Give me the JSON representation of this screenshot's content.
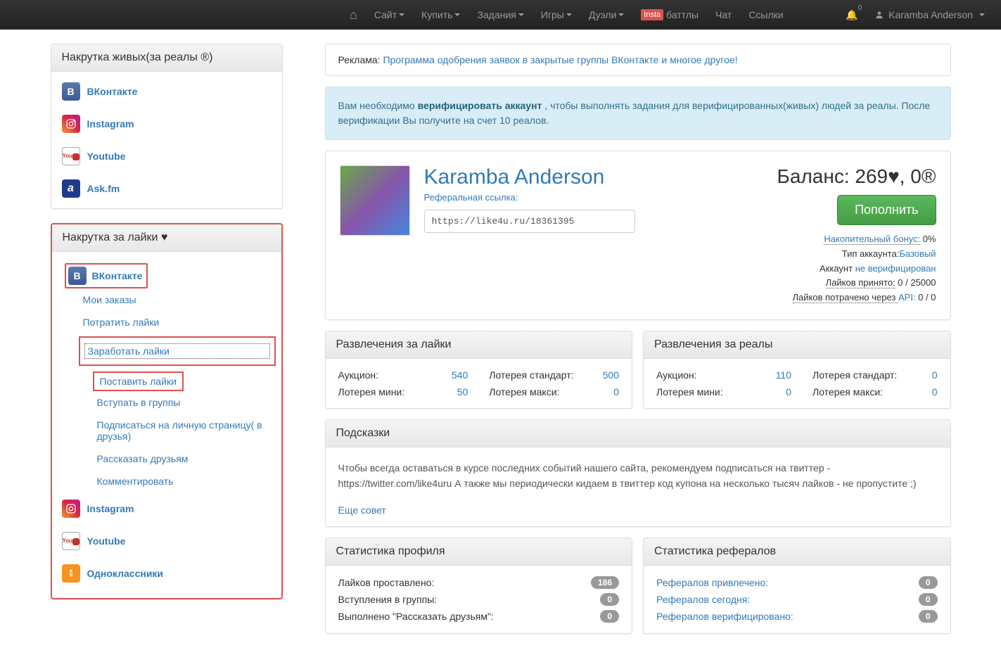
{
  "nav": {
    "site": "Сайт",
    "buy": "Купить",
    "tasks": "Задания",
    "games": "Игры",
    "duels": "Дуэли",
    "insta": "Insta",
    "battles": "баттлы",
    "chat": "Чат",
    "links": "Ссылки",
    "notif_count": "0",
    "user": "Karamba Anderson"
  },
  "sidebar1": {
    "title": "Накрутка живых(за реалы ®)",
    "vk": "ВКонтакте",
    "insta": "Instagram",
    "yt": "Youtube",
    "ask": "Ask.fm"
  },
  "sidebar2": {
    "title": "Накрутка за лайки ♥",
    "vk": "ВКонтакте",
    "sub": {
      "orders": "Мои заказы",
      "spend": "Потратить лайки",
      "earn": "Заработать лайки",
      "put": "Поставить лайки",
      "groups": "Вступать в группы",
      "subscribe": "Подписаться на личную страницу( в друзья)",
      "tell": "Рассказать друзьям",
      "comment": "Комментировать"
    },
    "insta2": "Instagram",
    "yt2": "Youtube",
    "ok": "Одноклассники"
  },
  "ad": {
    "label": "Реклама: ",
    "text": "Программа одобрения заявок в закрытые группы ВКонтакте и многое другое!"
  },
  "alert": {
    "p1": "Вам необходимо ",
    "link": "верифицировать аккаунт",
    "p2": " , чтобы выполнять задания для верифицированных(живых) людей за реалы. После верификации Вы получите на счет 10 реалов."
  },
  "profile": {
    "name": "Karamba Anderson",
    "ref_label": "Реферальная ссылка:",
    "ref_value": "https://like4u.ru/18361395",
    "balance": "Баланс: 269♥, 0®",
    "topup": "Пополнить",
    "bonus_l": "Накопительный бонус:",
    "bonus_v": " 0%",
    "type_l": "Тип аккаунта:",
    "type_v": "Базовый",
    "acct_l": "Аккаунт ",
    "acct_v": "не верифицирован",
    "likes_rcv_l": "Лайков принято:",
    "likes_rcv_v": " 0 / 25000",
    "likes_api_l": "Лайков потрачено через ",
    "api": "API:",
    "likes_api_v": " 0 / 0"
  },
  "ent_likes": {
    "title": "Развлечения за лайки",
    "auc_l": "Аукцион:",
    "auc_v": "540",
    "lstd_l": "Лотерея стандарт:",
    "lstd_v": "500",
    "lmin_l": "Лотерея мини:",
    "lmin_v": "50",
    "lmax_l": "Лотерея макси:",
    "lmax_v": "0"
  },
  "ent_reals": {
    "title": "Развлечения за реалы",
    "auc_l": "Аукцион:",
    "auc_v": "110",
    "lstd_l": "Лотерея стандарт:",
    "lstd_v": "0",
    "lmin_l": "Лотерея мини:",
    "lmin_v": "0",
    "lmax_l": "Лотерея макси:",
    "lmax_v": "0"
  },
  "tips": {
    "title": "Подсказки",
    "body": "Чтобы всегда оставаться в курсе последних событий нашего сайта, рекомендуем подписаться на твиттер - https://twitter.com/like4uru А также мы периодически кидаем в твиттер код купона на несколько тысяч лайков - не пропустите ;)",
    "more": "Еще совет"
  },
  "stats_profile": {
    "title": "Статистика профиля",
    "r1_l": "Лайков проставлено:",
    "r1_v": "186",
    "r2_l": "Вступления в группы:",
    "r2_v": "0",
    "r3_l": "Выполнено \"Рассказать друзьям\":",
    "r3_v": "0"
  },
  "stats_ref": {
    "title": "Статистика рефералов",
    "r1_l": "Рефералов привлечено:",
    "r1_v": "0",
    "r2_l": "Рефералов сегодня:",
    "r2_v": "0",
    "r3_l": "Рефералов верифицировано:",
    "r3_v": "0"
  }
}
